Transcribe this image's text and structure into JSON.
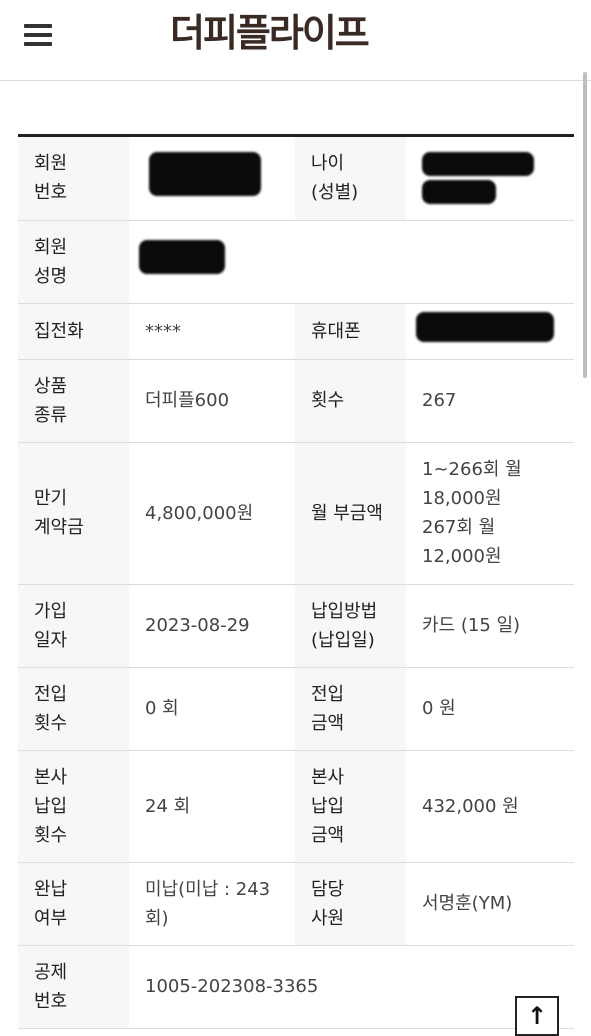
{
  "header": {
    "logo_text": "더피플라이프",
    "menu_icon": "hamburger-menu-icon"
  },
  "member_info": {
    "rows": [
      {
        "label_a": "회원\n번호",
        "value_a": "[redacted]",
        "label_b": "나이\n(성별)",
        "value_b": "[redacted]"
      },
      {
        "label_a": "회원\n성명",
        "value_a": "[redacted]"
      },
      {
        "label_a": "집전화",
        "value_a": "****",
        "label_b": "휴대폰",
        "value_b": "[redacted]"
      },
      {
        "label_a": "상품\n종류",
        "value_a": "더피플600",
        "label_b": "횟수",
        "value_b": "267"
      },
      {
        "label_a": "만기\n계약금",
        "value_a": "4,800,000원",
        "label_b": "월 부금액",
        "value_b": "1~266회 월\n18,000원\n267회 월\n12,000원"
      },
      {
        "label_a": "가입\n일자",
        "value_a": "2023-08-29",
        "label_b": "납입방법\n(납입일)",
        "value_b": "카드 (15 일)"
      },
      {
        "label_a": "전입\n횟수",
        "value_a": "0 회",
        "label_b": "전입\n금액",
        "value_b": "0 원"
      },
      {
        "label_a": "본사\n납입\n횟수",
        "value_a": "24 회",
        "label_b": "본사\n납입\n금액",
        "value_b": "432,000 원"
      },
      {
        "label_a": "완납\n여부",
        "value_a": "미납(미납 : 243\n회)",
        "label_b": "담당\n사원",
        "value_b": "서명훈(YM)"
      },
      {
        "label_a": "공제\n번호",
        "value_a": "1005-202308-3365"
      }
    ]
  },
  "scroll_top_icon": "arrow-up-icon"
}
